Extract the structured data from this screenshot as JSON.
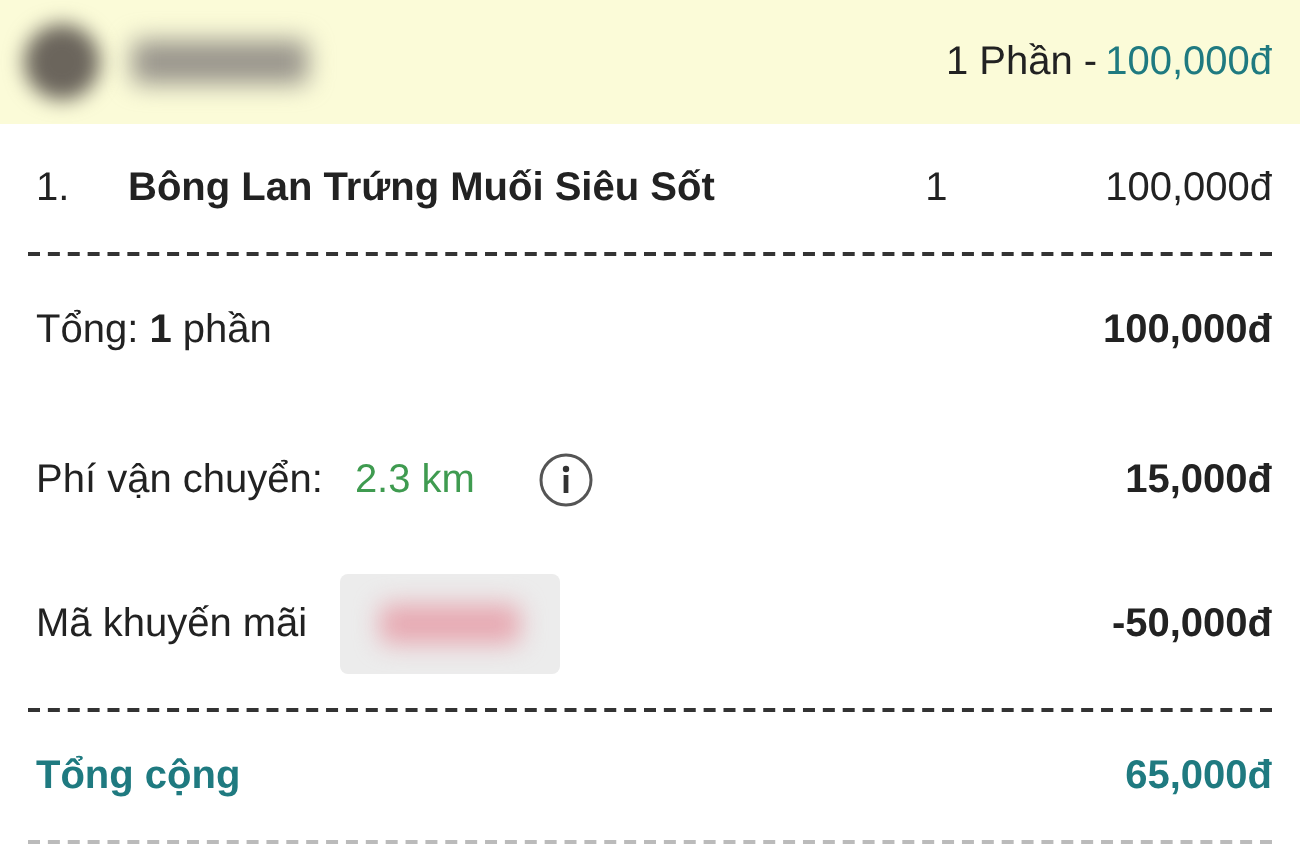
{
  "header": {
    "portions": "1 Phần -",
    "price": "100,000đ"
  },
  "items": [
    {
      "index": "1.",
      "name": "Bông Lan Trứng Muối Siêu Sốt",
      "qty": "1",
      "price": "100,000đ"
    }
  ],
  "subtotal": {
    "label": "Tổng: **1** phần",
    "value": "100,000đ"
  },
  "shipping": {
    "label": "Phí vận chuyển:",
    "distance": "2.3 km",
    "value": "15,000đ"
  },
  "promo": {
    "label": "Mã khuyến mãi",
    "value": "-50,000đ"
  },
  "total": {
    "label": "Tổng cộng",
    "value": "65,000đ"
  }
}
